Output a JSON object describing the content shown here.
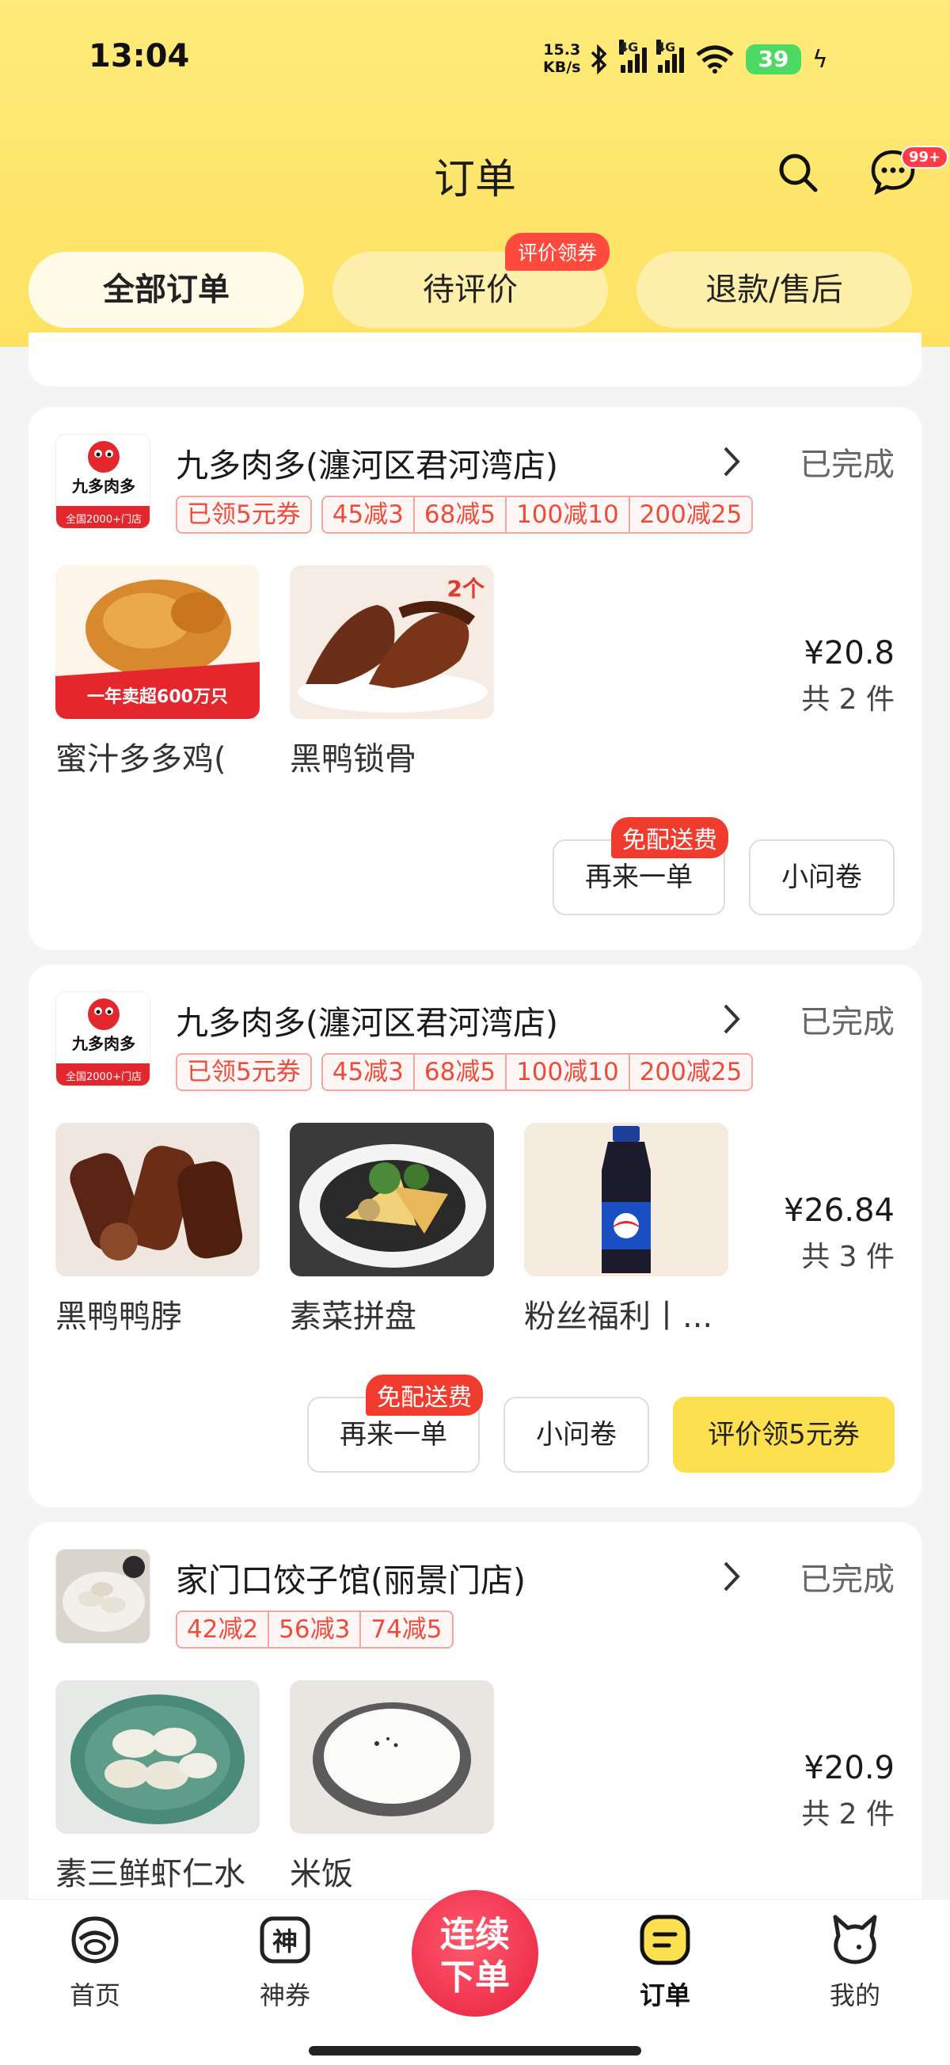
{
  "status_bar": {
    "time": "13:04",
    "speed": "15.3",
    "speed_unit": "KB/s",
    "network": "4G",
    "battery": "39"
  },
  "header": {
    "title": "订单"
  },
  "tabs": [
    {
      "label": "全部订单",
      "active": true
    },
    {
      "label": "待评价",
      "badge": "评价领券"
    },
    {
      "label": "退款/售后"
    }
  ],
  "messages": {
    "badge": "99+"
  },
  "orders": [
    {
      "store": "九多肉多(瀍河区君河湾店)",
      "status": "已完成",
      "logo_text": "九多肉多",
      "logo_sub": "全国2000+门店",
      "claimed_coupon": "已领5元券",
      "discounts": [
        "45减3",
        "68减5",
        "100减10",
        "200减25"
      ],
      "items": [
        {
          "name": "蜜汁多多鸡(",
          "banner": "一年卖超600万只"
        },
        {
          "name": "黑鸭锁骨",
          "qty": "2个"
        }
      ],
      "price": "¥20.8",
      "count": "共 2 件",
      "buttons": {
        "reorder": "再来一单",
        "reorder_badge": "免配送费",
        "survey": "小问卷"
      }
    },
    {
      "store": "九多肉多(瀍河区君河湾店)",
      "status": "已完成",
      "logo_text": "九多肉多",
      "logo_sub": "全国2000+门店",
      "claimed_coupon": "已领5元券",
      "discounts": [
        "45减3",
        "68减5",
        "100减10",
        "200减25"
      ],
      "items": [
        {
          "name": "黑鸭鸭脖"
        },
        {
          "name": "素菜拼盘"
        },
        {
          "name": "粉丝福利丨..."
        }
      ],
      "price": "¥26.84",
      "count": "共 3 件",
      "buttons": {
        "reorder": "再来一单",
        "reorder_badge": "免配送费",
        "survey": "小问卷",
        "review": "评价领5元券"
      }
    },
    {
      "store": "家门口饺子馆(丽景门店)",
      "status": "已完成",
      "discounts": [
        "42减2",
        "56减3",
        "74减5"
      ],
      "items": [
        {
          "name": "素三鲜虾仁水"
        },
        {
          "name": "米饭"
        }
      ],
      "price": "¥20.9",
      "count": "共 2 件"
    }
  ],
  "bottom_nav": [
    {
      "label": "首页",
      "icon": "home-icon"
    },
    {
      "label": "神券",
      "icon": "coupon-icon",
      "glyph": "神"
    },
    {
      "label": "连续下单",
      "icon": "reorder-icon",
      "line1": "连续",
      "line2": "下单"
    },
    {
      "label": "订单",
      "icon": "orders-icon",
      "active": true
    },
    {
      "label": "我的",
      "icon": "profile-icon"
    }
  ],
  "colors": {
    "header_yellow": "#fde262",
    "accent_red": "#ee4b3b",
    "primary_button": "#fde04f"
  }
}
